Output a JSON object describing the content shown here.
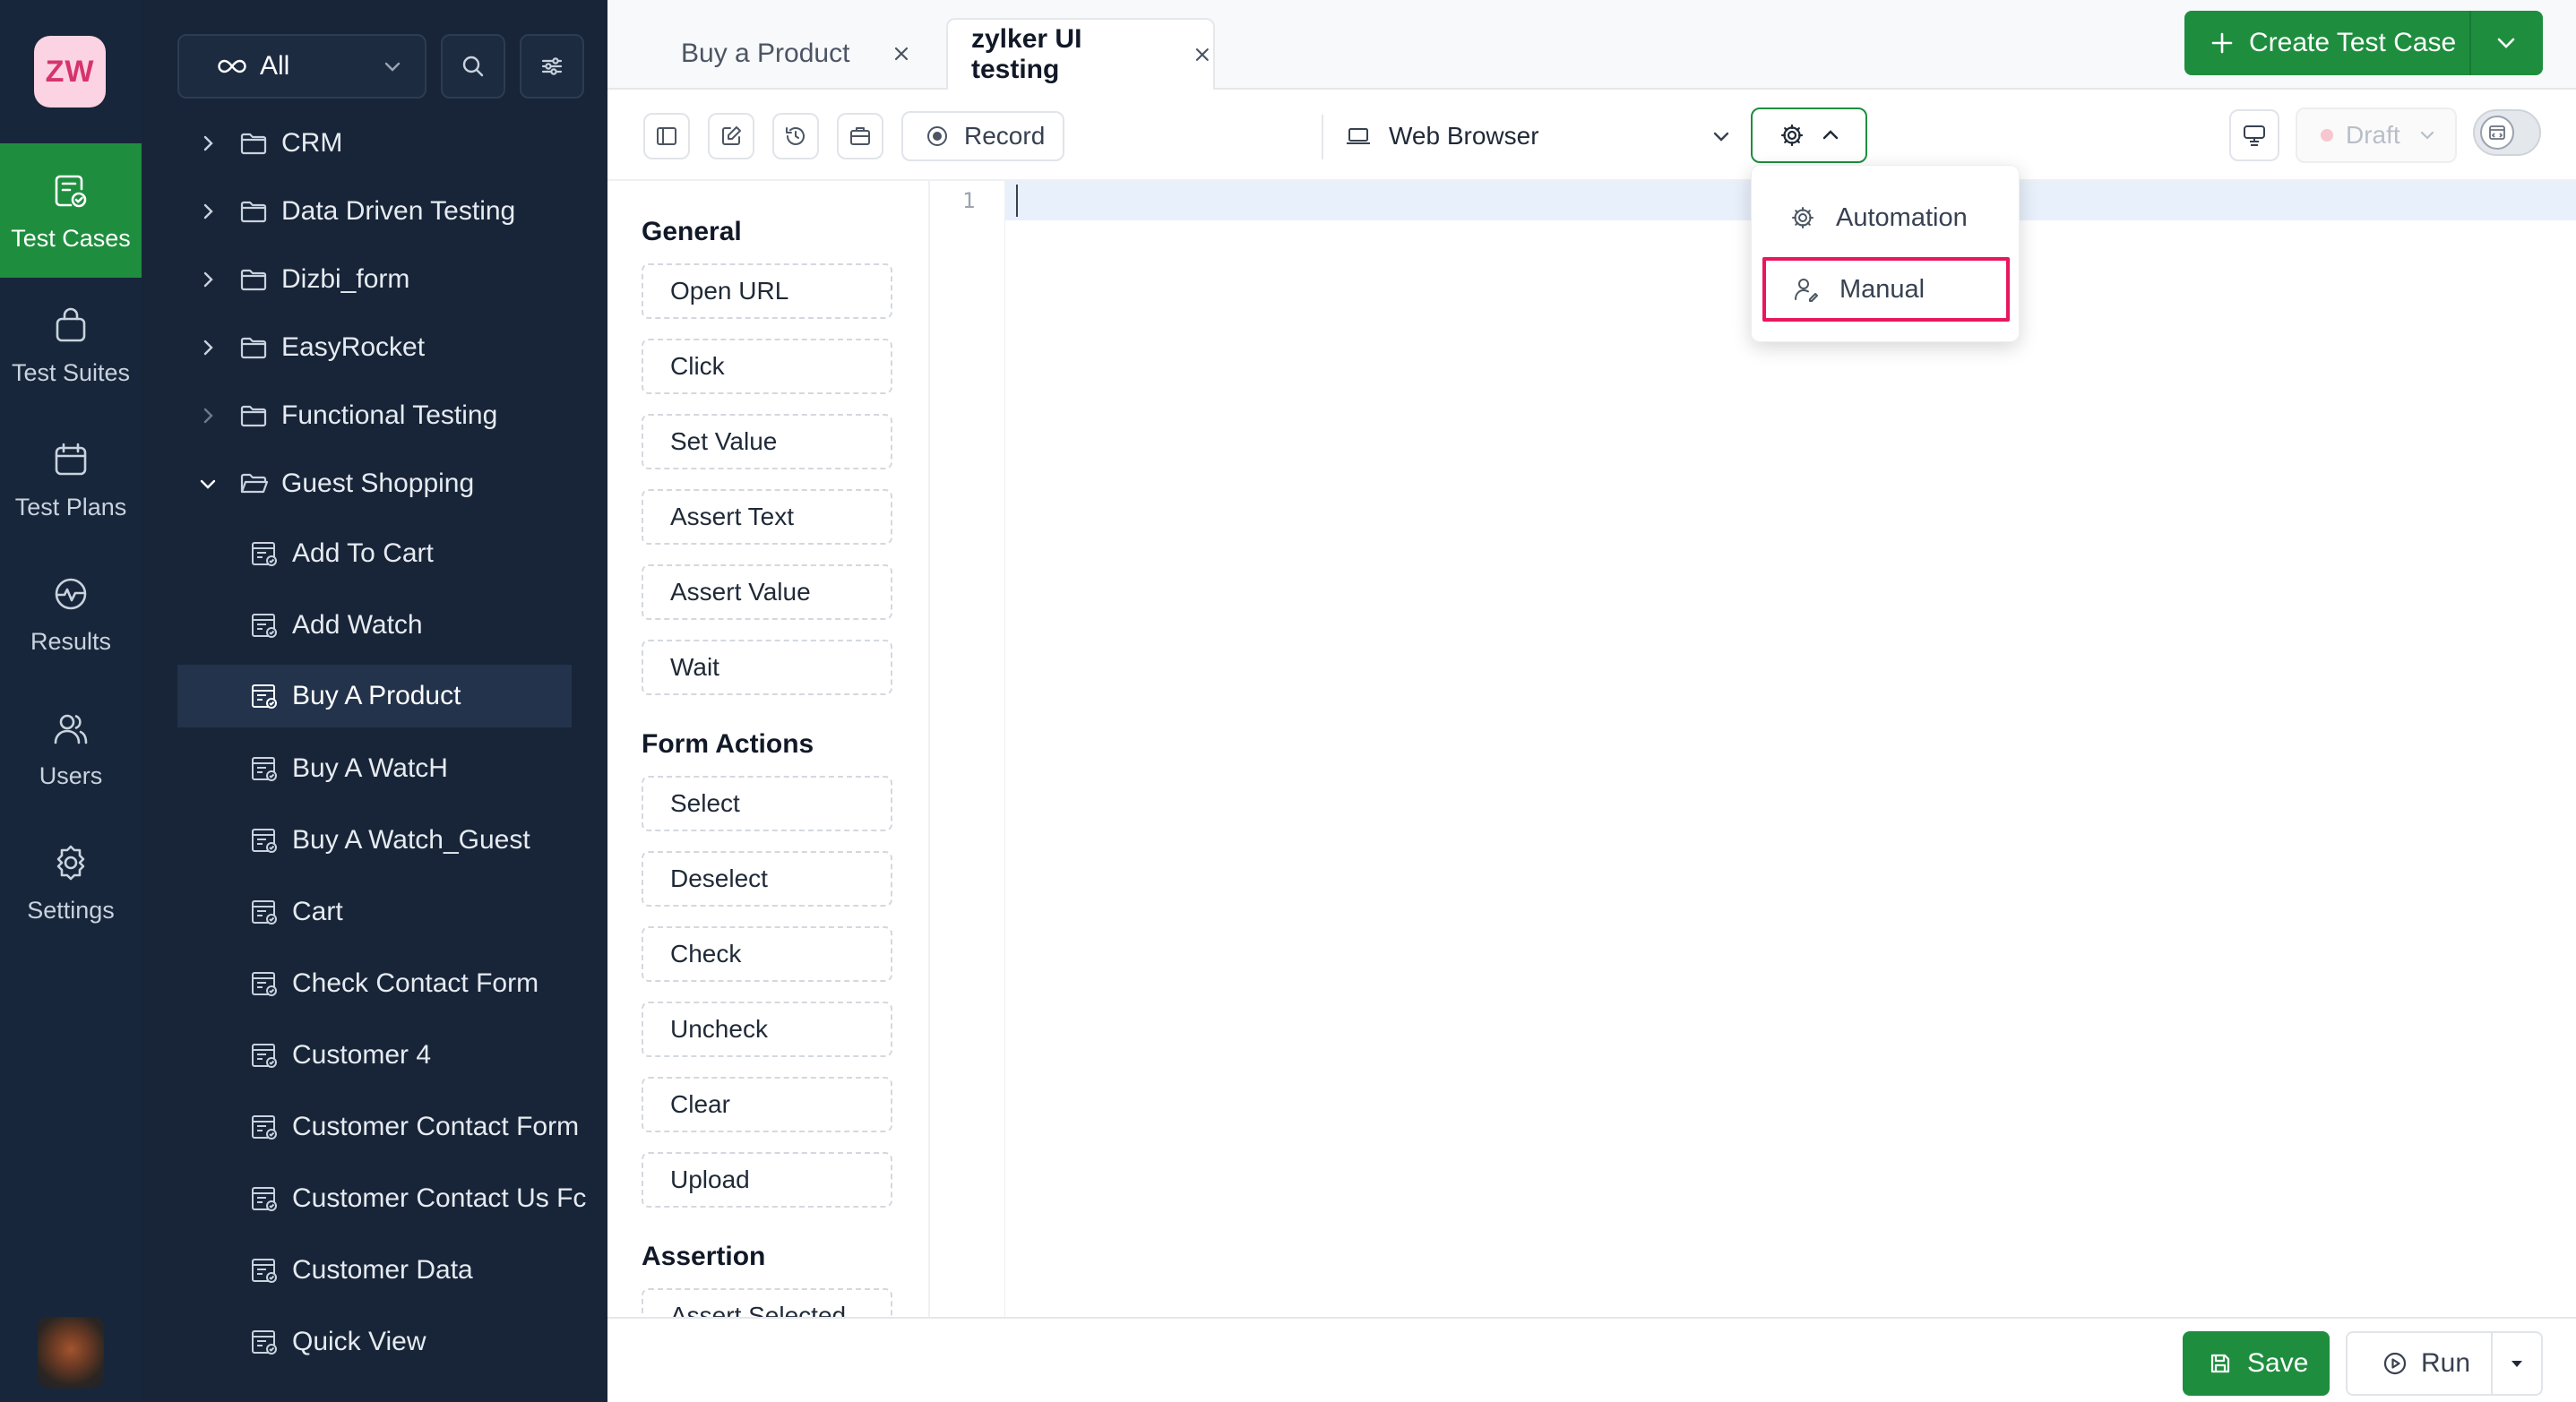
{
  "rail": {
    "logo_text": "ZW",
    "items": [
      {
        "label": "Test Cases",
        "icon": "test-cases-icon",
        "active": true
      },
      {
        "label": "Test Suites",
        "icon": "test-suites-icon"
      },
      {
        "label": "Test Plans",
        "icon": "test-plans-icon"
      },
      {
        "label": "Results",
        "icon": "results-icon"
      },
      {
        "label": "Users",
        "icon": "users-icon"
      },
      {
        "label": "Settings",
        "icon": "settings-icon"
      }
    ]
  },
  "tree": {
    "filter_label": "All",
    "folders": [
      {
        "label": "CRM"
      },
      {
        "label": "Data Driven Testing"
      },
      {
        "label": "Dizbi_form"
      },
      {
        "label": "EasyRocket"
      },
      {
        "label": "Functional Testing"
      },
      {
        "label": "Guest Shopping",
        "expanded": true
      }
    ],
    "cases": [
      {
        "label": "Add To Cart"
      },
      {
        "label": "Add Watch"
      },
      {
        "label": "Buy A Product",
        "selected": true
      },
      {
        "label": "Buy A WatcH"
      },
      {
        "label": "Buy A Watch_Guest"
      },
      {
        "label": "Cart"
      },
      {
        "label": "Check Contact Form"
      },
      {
        "label": "Customer 4"
      },
      {
        "label": "Customer Contact Form"
      },
      {
        "label": "Customer Contact Us Fc"
      },
      {
        "label": "Customer Data"
      },
      {
        "label": "Quick View"
      }
    ]
  },
  "tabs": [
    {
      "label": "Buy a Product"
    },
    {
      "label": "zylker UI testing",
      "active": true
    }
  ],
  "header": {
    "create_label": "Create Test Case"
  },
  "toolbar": {
    "record_label": "Record",
    "browser_label": "Web Browser",
    "status_label": "Draft"
  },
  "palette": {
    "sections": [
      {
        "title": "General",
        "items": [
          "Open URL",
          "Click",
          "Set Value",
          "Assert Text",
          "Assert Value",
          "Wait"
        ]
      },
      {
        "title": "Form Actions",
        "items": [
          "Select",
          "Deselect",
          "Check",
          "Uncheck",
          "Clear",
          "Upload"
        ]
      },
      {
        "title": "Assertion",
        "items": [
          "Assert Selected"
        ]
      }
    ]
  },
  "editor": {
    "line_number": "1"
  },
  "mode_menu": {
    "automation_label": "Automation",
    "manual_label": "Manual"
  },
  "footer": {
    "save_label": "Save",
    "run_label": "Run"
  },
  "colors": {
    "accent": "#1e8e3e",
    "sidebar": "#17263a",
    "highlight": "#e8175d"
  }
}
